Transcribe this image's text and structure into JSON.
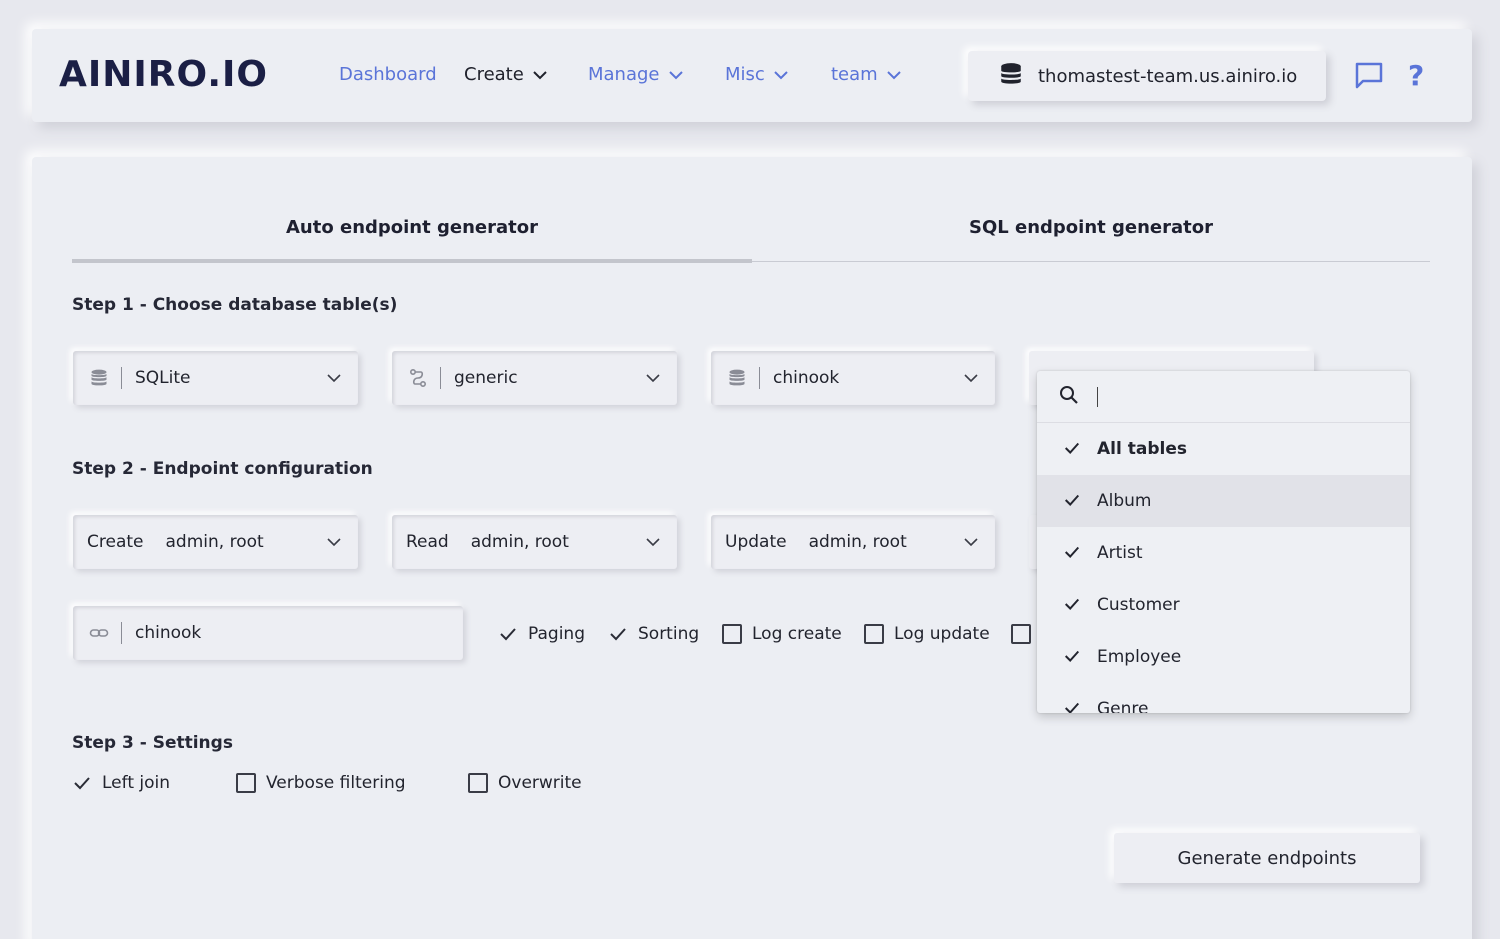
{
  "header": {
    "logo": "AINIRO.IO",
    "nav": [
      {
        "label": "Dashboard"
      },
      {
        "label": "Create"
      },
      {
        "label": "Manage"
      },
      {
        "label": "Misc"
      },
      {
        "label": "team"
      }
    ],
    "server": "thomastest-team.us.ainiro.io",
    "help": "?"
  },
  "tabs": [
    {
      "label": "Auto endpoint generator",
      "active": true
    },
    {
      "label": "SQL endpoint generator",
      "active": false
    }
  ],
  "step1": {
    "title": "Step 1 - Choose database table(s)",
    "database_type": "SQLite",
    "connection": "generic",
    "database": "chinook"
  },
  "step2": {
    "title": "Step 2 - Endpoint configuration",
    "create": {
      "label": "Create",
      "value": "admin, root"
    },
    "read": {
      "label": "Read",
      "value": "admin, root"
    },
    "update": {
      "label": "Update",
      "value": "admin, root"
    },
    "module_name": "chinook",
    "options": [
      {
        "label": "Paging",
        "checked": true
      },
      {
        "label": "Sorting",
        "checked": true
      },
      {
        "label": "Log create",
        "checked": false
      },
      {
        "label": "Log update",
        "checked": false
      }
    ]
  },
  "step3": {
    "title": "Step 3 - Settings",
    "options": [
      {
        "label": "Left join",
        "checked": true
      },
      {
        "label": "Verbose filtering",
        "checked": false
      },
      {
        "label": "Overwrite",
        "checked": false
      }
    ]
  },
  "generate_button": "Generate endpoints",
  "tables_dropdown": {
    "search_value": "",
    "items": [
      {
        "label": "All tables",
        "checked": true
      },
      {
        "label": "Album",
        "checked": true
      },
      {
        "label": "Artist",
        "checked": true
      },
      {
        "label": "Customer",
        "checked": true
      },
      {
        "label": "Employee",
        "checked": true
      },
      {
        "label": "Genre",
        "checked": true
      }
    ]
  },
  "colors": {
    "accent": "#5a74d8",
    "background": "#e7e8ee",
    "surface": "#eceef3",
    "logo": "#1b1f45"
  }
}
